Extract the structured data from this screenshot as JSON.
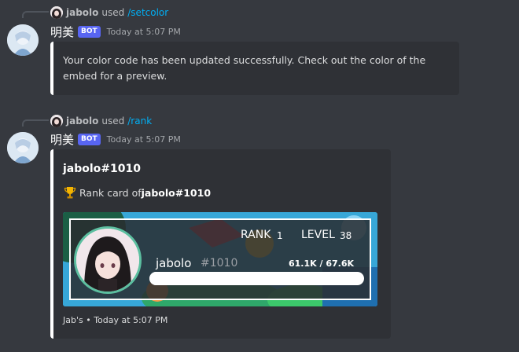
{
  "messages": [
    {
      "reply": {
        "user": "jabolo",
        "used": "used",
        "command": "/setcolor"
      },
      "author": "明美",
      "bot_tag": "BOT",
      "timestamp": "Today at 5:07 PM",
      "embed": {
        "description": "Your color code has been updated successfully. Check out the color of the embed for a preview."
      }
    },
    {
      "reply": {
        "user": "jabolo",
        "used": "used",
        "command": "/rank"
      },
      "author": "明美",
      "bot_tag": "BOT",
      "timestamp": "Today at 5:07 PM",
      "embed": {
        "title": "jabolo#1010",
        "description_prefix": "Rank card of ",
        "description_user": "jabolo#1010",
        "footer": "Jab's • Today at 5:07 PM",
        "rank_card": {
          "rank_label": "RANK",
          "rank_value": "1",
          "level_label": "LEVEL",
          "level_value": "38",
          "username": "jabolo",
          "discriminator": "#1010",
          "xp_text": "61.1K  / 67.6K",
          "progress": 0.904
        }
      }
    }
  ],
  "colors": {
    "embed_border": "#ffffff",
    "bot_tag": "#5865f2",
    "command_link": "#00aff4"
  },
  "icons": {
    "trophy": "trophy-icon"
  }
}
